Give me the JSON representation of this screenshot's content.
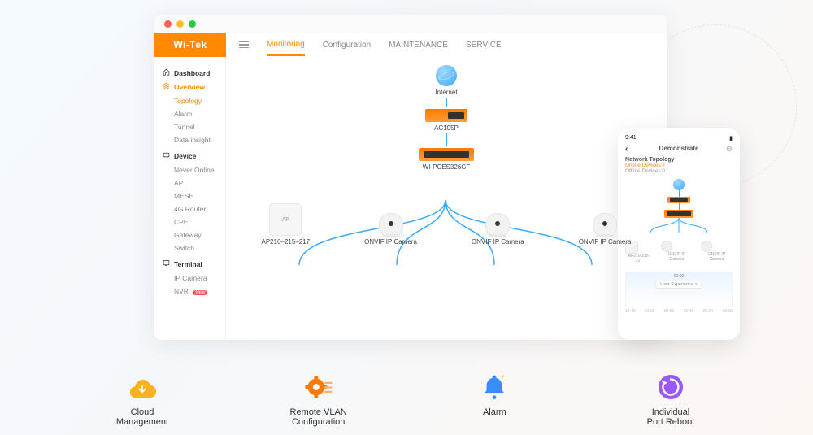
{
  "header": {
    "logo": "Wi‑Tek",
    "tabs": [
      "Monitoring",
      "Configuration",
      "MAINTENANCE",
      "SERVICE"
    ],
    "active_tab": 0
  },
  "sidebar": {
    "groups": [
      {
        "title": "Dashboard",
        "active": false,
        "items": []
      },
      {
        "title": "Overview",
        "active": true,
        "items": [
          "Topology",
          "Alarm",
          "Tunnel",
          "Data insight"
        ],
        "active_item": 0
      },
      {
        "title": "Device",
        "active": false,
        "items": [
          "Never Online",
          "AP",
          "MESH",
          "4G Router",
          "CPE",
          "Gateway",
          "Switch"
        ]
      },
      {
        "title": "Terminal",
        "active": false,
        "items": [
          "IP Camera",
          "NVR"
        ],
        "badge_item": 1,
        "badge_text": "New"
      }
    ]
  },
  "topology": {
    "internet": "Internet",
    "gateway": "AC105P",
    "switch": "WI-PCES326GF",
    "leaves": [
      {
        "type": "ap",
        "label": "AP210–215–217",
        "icon_text": "AP"
      },
      {
        "type": "cam",
        "label": "ONVIF IP Camera"
      },
      {
        "type": "cam",
        "label": "ONVIF IP Camera"
      },
      {
        "type": "cam",
        "label": "ONVIF IP Camera"
      }
    ]
  },
  "phone": {
    "time": "9:41",
    "title": "Demonstrate",
    "section": "Network Topology",
    "online": "Online Devices:7",
    "offline": "Offline Devices:0",
    "leaf_labels": [
      "AP210-215-217",
      "ONVIF IP Camera",
      "ONVIF IP Camera"
    ],
    "chart_center_time": "00:00",
    "chart_btn": "User Experience >",
    "xaxis": [
      "18:40",
      "21:20",
      "00:00",
      "02:40",
      "05:20",
      "08:00"
    ]
  },
  "features": [
    {
      "label": "Cloud\nManagement",
      "color": "#ffb020"
    },
    {
      "label": "Remote VLAN\nConfiguration",
      "color": "#ff7a00"
    },
    {
      "label": "Alarm",
      "color": "#3a8dff"
    },
    {
      "label": "Individual\nPort Reboot",
      "color": "#9a58ff"
    }
  ]
}
